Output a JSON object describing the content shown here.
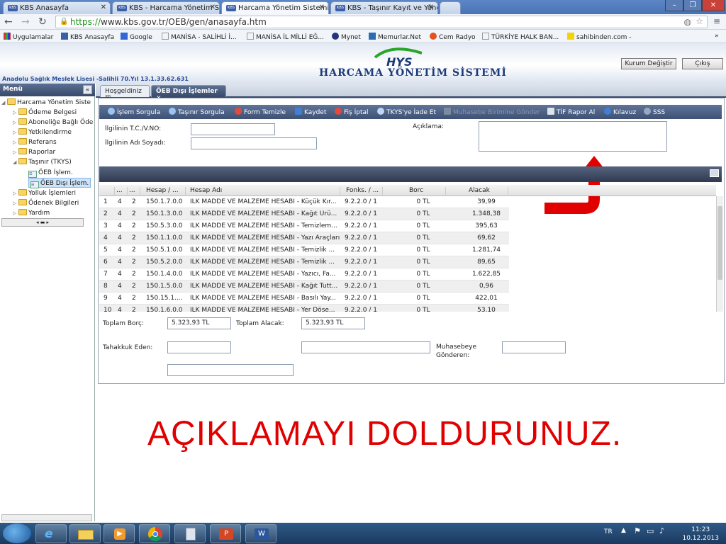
{
  "browser": {
    "tabs": [
      {
        "label": "KBS Anasayfa",
        "favicon": "KBS"
      },
      {
        "label": "KBS - Harcama Yönetim S",
        "favicon": "KBS"
      },
      {
        "label": "Harcama Yönetim Sistemi",
        "favicon": "KBS"
      },
      {
        "label": "KBS - Taşınır Kayıt ve Yöne",
        "favicon": "KBS"
      }
    ],
    "url_protocol": "https://",
    "url_rest": "www.kbs.gov.tr/OEB/gen/anasayfa.htm",
    "bookmarks": [
      "Uygulamalar",
      "KBS Anasayfa",
      "Google",
      "MANİSA - SALİHLİ İ...",
      "MANİSA İL MİLLİ EĞ...",
      "Mynet",
      "Memurlar.Net",
      "Cem Radyo",
      "TÜRKİYE HALK BAN...",
      "sahibinden.com -"
    ],
    "more": "»"
  },
  "header": {
    "logo_text": "HYS",
    "title": "HARCAMA YÖNETİM SİSTEMİ",
    "school": "Anadolu Sağlık Meslek Lisesi -Salihli 70.Yıl 13.1.33.62.631",
    "change_button": "Kurum Değiştir",
    "exit_button": "Çıkış"
  },
  "menu": {
    "title": "Menü",
    "collapse": "«",
    "tree": [
      {
        "label": "Harcama Yönetim Siste",
        "level": 0,
        "type": "folder",
        "expanded": true
      },
      {
        "label": "Ödeme Belgesi",
        "level": 1,
        "type": "folder"
      },
      {
        "label": "Aboneliğe Bağlı Öde",
        "level": 1,
        "type": "folder"
      },
      {
        "label": "Yetkilendirme",
        "level": 1,
        "type": "folder"
      },
      {
        "label": "Referans",
        "level": 1,
        "type": "folder"
      },
      {
        "label": "Raporlar",
        "level": 1,
        "type": "folder"
      },
      {
        "label": "Taşınır (TKYS)",
        "level": 1,
        "type": "folder",
        "expanded": true
      },
      {
        "label": "ÖEB İşlem.",
        "level": 2,
        "type": "doc"
      },
      {
        "label": "ÖEB Dışı İşlem.",
        "level": 2,
        "type": "doc",
        "selected": true
      },
      {
        "label": "Yolluk İşlemleri",
        "level": 1,
        "type": "folder"
      },
      {
        "label": "Ödenek Bilgileri",
        "level": 1,
        "type": "folder"
      },
      {
        "label": "Yardım",
        "level": 1,
        "type": "folder"
      }
    ]
  },
  "content_tabs": [
    {
      "label": "Hoşgeldiniz",
      "close": "☒"
    },
    {
      "label": "ÖEB Dışı İşlemler",
      "close": "✕"
    }
  ],
  "toolbar": [
    {
      "label": "İşlem Sorgula",
      "icon": "search-icon",
      "enabled": true
    },
    {
      "label": "Taşınır Sorgula",
      "icon": "search-icon",
      "enabled": true
    },
    {
      "label": "Form Temizle",
      "icon": "clear-icon",
      "enabled": true
    },
    {
      "label": "Kaydet",
      "icon": "save-icon",
      "enabled": true
    },
    {
      "label": "Fiş İptal",
      "icon": "cancel-icon",
      "enabled": true
    },
    {
      "label": "TKYS'ye İade Et",
      "icon": "return-icon",
      "enabled": true
    },
    {
      "label": "Muhasebe Birimine Gönder",
      "icon": "send-icon",
      "enabled": false
    },
    {
      "label": "TİF Rapor Al",
      "icon": "print-icon",
      "enabled": true
    },
    {
      "label": "Kılavuz",
      "icon": "help-icon",
      "enabled": true
    },
    {
      "label": "SSS",
      "icon": "faq-icon",
      "enabled": true
    }
  ],
  "form": {
    "tc_label": "İlgilinin T.C./V.NO:",
    "tc_value": "",
    "name_label": "İlgilinin Adı Soyadı:",
    "name_value": "",
    "desc_label": "Açıklama:",
    "desc_value": ""
  },
  "grid": {
    "headers": [
      "",
      "...",
      "...",
      "Hesap / ...",
      "Hesap Adı",
      "Fonks. / ...",
      "Borc",
      "Alacak"
    ],
    "rows": [
      [
        "1",
        "4",
        "2",
        "150.1.7.0.0",
        "İLK MADDE VE MALZEME HESABI - Küçük Kır...",
        "9.2.2.0 / 1",
        "0 TL",
        "39,99"
      ],
      [
        "2",
        "4",
        "2",
        "150.1.3.0.0",
        "İLK MADDE VE MALZEME HESABI - Kağıt Ürü...",
        "9.2.2.0 / 1",
        "0 TL",
        "1.348,38"
      ],
      [
        "3",
        "4",
        "2",
        "150.5.3.0.0",
        "İLK MADDE VE MALZEME HESABI - Temizlem...",
        "9.2.2.0 / 1",
        "0 TL",
        "395,63"
      ],
      [
        "4",
        "4",
        "2",
        "150.1.1.0.0",
        "İLK MADDE VE MALZEME HESABI - Yazı Araçları",
        "9.2.2.0 / 1",
        "0 TL",
        "69,62"
      ],
      [
        "5",
        "4",
        "2",
        "150.5.1.0.0",
        "İLK MADDE VE MALZEME HESABI - Temizlik ...",
        "9.2.2.0 / 1",
        "0 TL",
        "1.281,74"
      ],
      [
        "6",
        "4",
        "2",
        "150.5.2.0.0",
        "İLK MADDE VE MALZEME HESABI - Temizlik ...",
        "9.2.2.0 / 1",
        "0 TL",
        "89,65"
      ],
      [
        "7",
        "4",
        "2",
        "150.1.4.0.0",
        "İLK MADDE VE MALZEME HESABI - Yazıcı, Fa...",
        "9.2.2.0 / 1",
        "0 TL",
        "1.622,85"
      ],
      [
        "8",
        "4",
        "2",
        "150.1.5.0.0",
        "İLK MADDE VE MALZEME HESABI - Kağıt Tutt...",
        "9.2.2.0 / 1",
        "0 TL",
        "0,96"
      ],
      [
        "9",
        "4",
        "2",
        "150.15.1....",
        "İLK MADDE VE MALZEME HESABI - Basılı Yay...",
        "9.2.2.0 / 1",
        "0 TL",
        "422,01"
      ],
      [
        "10",
        "4",
        "2",
        "150.1.6.0.0",
        "İLK MADDE VE MALZEME HESABI - Yer Döşe...",
        "9.2.2.0 / 1",
        "0 TL",
        "53,10"
      ]
    ]
  },
  "totals": {
    "borc_label": "Toplam Borç:",
    "borc_value": "5.323,93 TL",
    "alacak_label": "Toplam Alacak:",
    "alacak_value": "5.323,93 TL"
  },
  "bottom_form": {
    "tahakkuk_label": "Tahakkuk Eden:",
    "muhasebe_label_1": "Muhasebeye",
    "muhasebe_label_2": "Gönderen:"
  },
  "instruction": "AÇIKLAMAYI DOLDURUNUZ.",
  "taskbar": {
    "lang": "TR",
    "time": "11:23",
    "date": "10.12.2013"
  },
  "colors": {
    "arrow": "#e00000",
    "toolbar_bg": "#4a5d80",
    "instruction": "#e00000"
  }
}
